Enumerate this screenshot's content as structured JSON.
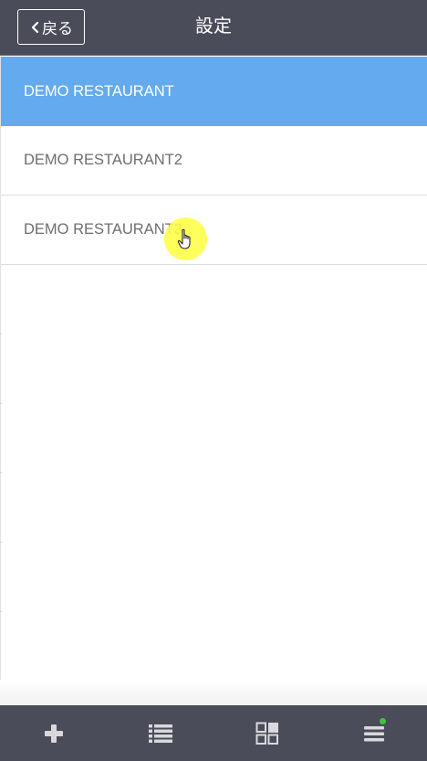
{
  "header": {
    "back_label": "戻る",
    "title": "設定"
  },
  "list": {
    "items": [
      {
        "label": "DEMO RESTAURANT",
        "selected": true
      },
      {
        "label": "DEMO RESTAURANT2",
        "selected": false
      },
      {
        "label": "DEMO RESTAURANT3",
        "selected": false
      }
    ]
  },
  "tabbar": {
    "tabs": [
      {
        "icon": "plus-icon"
      },
      {
        "icon": "list-icon"
      },
      {
        "icon": "grid-icon"
      },
      {
        "icon": "menu-icon",
        "has_notification": true
      }
    ]
  },
  "colors": {
    "header_bg": "#4a4c59",
    "selected_bg": "#64aaee",
    "notification": "#3ec63e"
  }
}
